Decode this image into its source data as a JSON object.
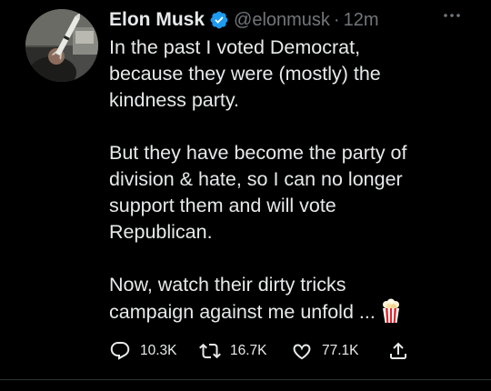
{
  "author": {
    "name": "Elon Musk",
    "handle": "@elonmusk",
    "separator": "·",
    "time": "12m",
    "verified_icon": "verified-badge-icon"
  },
  "tweet": {
    "paragraphs": [
      [
        "In the past I voted Democrat,",
        "because they were (mostly) the",
        "kindness party."
      ],
      [
        "But they have become the party of",
        "division & hate, so I can no longer",
        "support them and will vote",
        "Republican."
      ],
      [
        "Now, watch their dirty tricks",
        "campaign against me unfold ..."
      ]
    ],
    "emoji_icon": "popcorn-icon"
  },
  "actions": {
    "reply_count": "10.3K",
    "retweet_count": "16.7K",
    "like_count": "77.1K",
    "icons": [
      "reply-icon",
      "retweet-icon",
      "like-icon",
      "share-icon"
    ]
  },
  "colors": {
    "background": "#000000",
    "text": "#e7e9ea",
    "muted": "#71767b",
    "verified": "#1d9bf0",
    "divider": "#2f3336"
  }
}
